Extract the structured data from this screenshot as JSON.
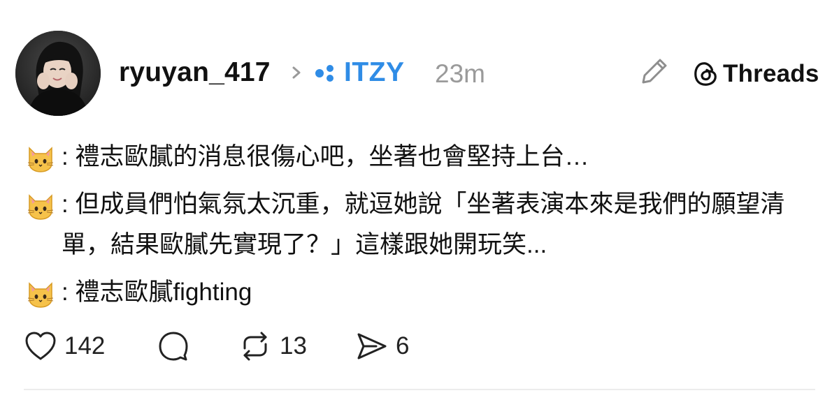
{
  "post": {
    "author": {
      "username": "ryuyan_417",
      "avatar": "avatar-photo"
    },
    "community": {
      "name": "ITZY",
      "color": "#2f8ce6",
      "icon": "community-dots-icon"
    },
    "time_ago": "23m",
    "brand": {
      "label": "Threads",
      "icon": "threads-logo-icon"
    },
    "lines": [
      {
        "emoji": "cat-face-emoji",
        "text": ": 禮志歐膩的消息很傷心吧，坐著也會堅持上台…"
      },
      {
        "emoji": "cat-face-emoji",
        "text": ": 但成員們怕氣氛太沉重，就逗她說「坐著表演本來是我們的願望清單，結果歐膩先實現了？」這樣跟她開玩笑..."
      },
      {
        "emoji": "cat-face-emoji",
        "text": ": 禮志歐膩fighting"
      }
    ],
    "actions": {
      "likes": "142",
      "comments": "",
      "reposts": "13",
      "shares": "6"
    }
  }
}
